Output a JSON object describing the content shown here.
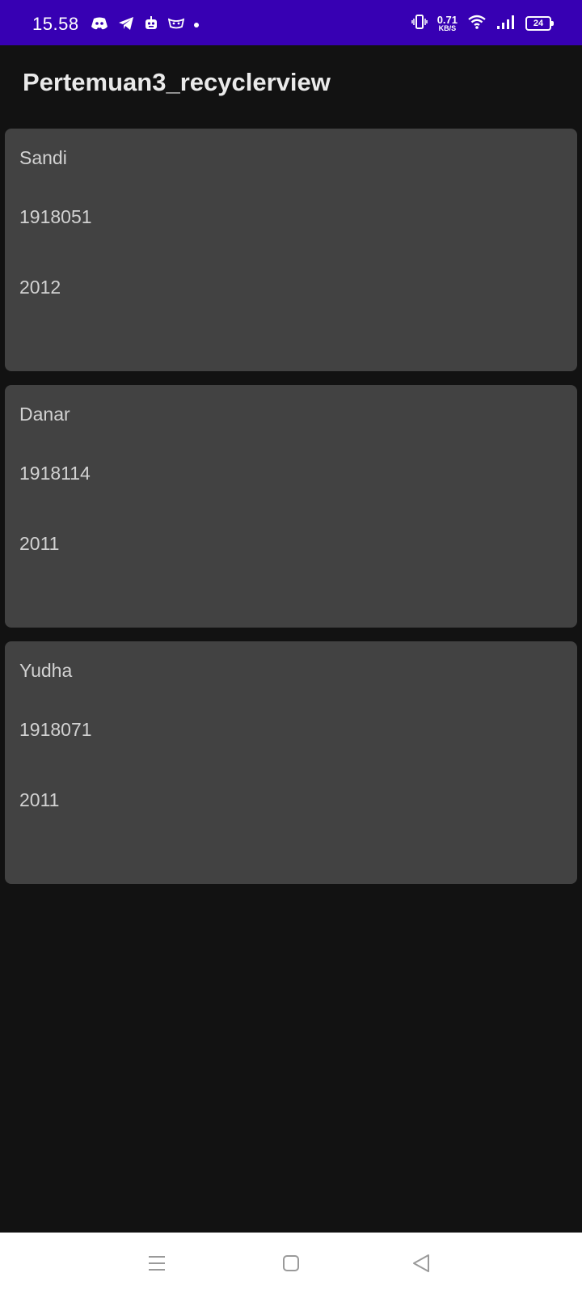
{
  "status_bar": {
    "time": "15.58",
    "left_icons": [
      "discord-icon",
      "telegram-icon",
      "bot-icon",
      "mask-icon",
      "dot-icon"
    ],
    "net_speed_value": "0.71",
    "net_speed_unit": "KB/S",
    "battery_level": "24",
    "right_icons": [
      "vibrate-icon",
      "wifi-icon",
      "signal-icon",
      "battery-icon"
    ]
  },
  "app_bar": {
    "title": "Pertemuan3_recyclerview"
  },
  "items": [
    {
      "name": "Sandi",
      "id": "1918051",
      "year": "2012"
    },
    {
      "name": "Danar",
      "id": "1918114",
      "year": "2011"
    },
    {
      "name": "Yudha",
      "id": "1918071",
      "year": "2011"
    }
  ],
  "nav_bar": {
    "buttons": [
      "menu-icon",
      "home-icon",
      "back-icon"
    ]
  },
  "colors": {
    "status_bar": "#3700b3",
    "background": "#121212",
    "card": "#424242",
    "text": "#d2d2d2"
  }
}
